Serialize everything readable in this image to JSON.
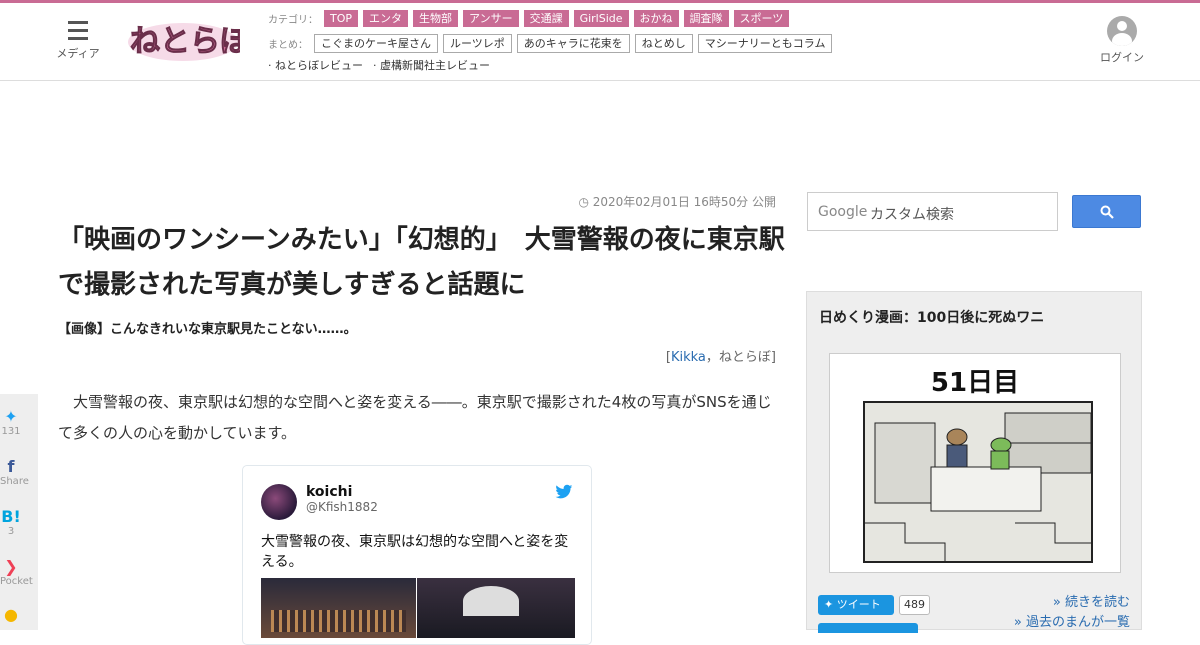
{
  "header": {
    "menu_label": "メディア",
    "login_label": "ログイン",
    "category_label": "カテゴリ：",
    "categories": [
      "TOP",
      "エンタ",
      "生物部",
      "アンサー",
      "交通課",
      "GirlSide",
      "おかね",
      "調査隊",
      "スポーツ"
    ],
    "matome_label": "まとめ：",
    "matome": [
      "こぐまのケーキ屋さん",
      "ルーツレポ",
      "あのキャラに花束を",
      "ねとめし",
      "マシーナリーともコラム"
    ],
    "reviews": [
      "· ねとらぼレビュー",
      "· 虚構新聞社主レビュー"
    ]
  },
  "article": {
    "date": "2020年02月01日 16時50分 公開",
    "title": "「映画のワンシーンみたい」「幻想的」　大雪警報の夜に東京駅で撮影された写真が美しすぎると話題に",
    "subtitle": "【画像】こんなきれいな東京駅見たことない……。",
    "byline_open": "[",
    "author": "Kikka",
    "byline_sep": "，",
    "publisher": "ねとらぼ",
    "byline_close": "]",
    "lead": "　大雪警報の夜、東京駅は幻想的な空間へと姿を変える――。東京駅で撮影された4枚の写真がSNSを通じて多くの人の心を動かしています。"
  },
  "tweet": {
    "name": "koichi",
    "handle": "@Kfish1882",
    "text": "大雪警報の夜、東京駅は幻想的な空間へと姿を変える。"
  },
  "share": [
    {
      "icon": "twitter-icon",
      "glyph": "✦",
      "count": "131"
    },
    {
      "icon": "facebook-icon",
      "glyph": "f",
      "count": "Share"
    },
    {
      "icon": "hatena-bookmark-icon",
      "glyph": "B!",
      "count": "3"
    },
    {
      "icon": "pocket-icon",
      "glyph": "❯",
      "count": "Pocket"
    }
  ],
  "search": {
    "brand": "Google",
    "placeholder": "カスタム検索"
  },
  "sidebar": {
    "manga_title": "日めくり漫画：100日後に死ぬワニ",
    "day_label": "51日目",
    "tweet_button": "ツイート",
    "tweet_count": "489",
    "read_more": "» 続きを読む",
    "past": "» 過去のまんが一覧"
  },
  "colors": {
    "brand_pink": "#c96b94",
    "link_blue": "#2a6cb0",
    "search_button": "#4d8ae3",
    "twitter_blue": "#1b95e0"
  }
}
